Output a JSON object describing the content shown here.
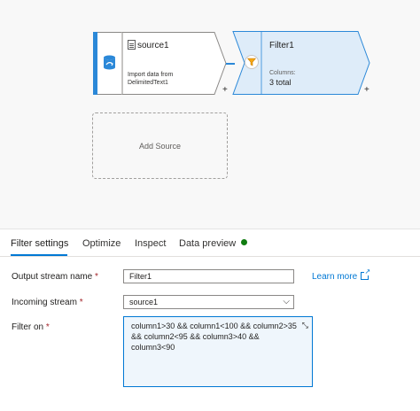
{
  "canvas": {
    "source_node": {
      "title": "source1",
      "description_line1": "Import data from",
      "description_line2": "DelimitedText1",
      "plus": "+"
    },
    "filter_node": {
      "title": "Filter1",
      "columns_label": "Columns:",
      "columns_value": "3 total",
      "plus": "+"
    },
    "add_source_label": "Add Source"
  },
  "tabs": [
    {
      "label": "Filter settings",
      "active": true
    },
    {
      "label": "Optimize",
      "active": false
    },
    {
      "label": "Inspect",
      "active": false
    },
    {
      "label": "Data preview",
      "active": false
    }
  ],
  "form": {
    "output_stream": {
      "label": "Output stream name",
      "required": "*",
      "value": "Filter1"
    },
    "learn_more": "Learn more",
    "incoming_stream": {
      "label": "Incoming stream",
      "required": "*",
      "value": "source1"
    },
    "filter_on": {
      "label": "Filter on",
      "required": "*",
      "line1": "column1>30 && column1<100 && column2>35",
      "line2": "&& column2<95 && column3>40 &&",
      "line3": "column3<90"
    }
  },
  "colors": {
    "accent": "#0078d4",
    "filter_node_fill": "#deecf9",
    "status_dot": "#107c10",
    "source_bar": "#2b88d8"
  },
  "icons": {
    "source": "database-icon",
    "filter": "funnel-icon",
    "external": "external-link-icon",
    "chevron": "chevron-down-icon",
    "expand": "expand-icon"
  }
}
